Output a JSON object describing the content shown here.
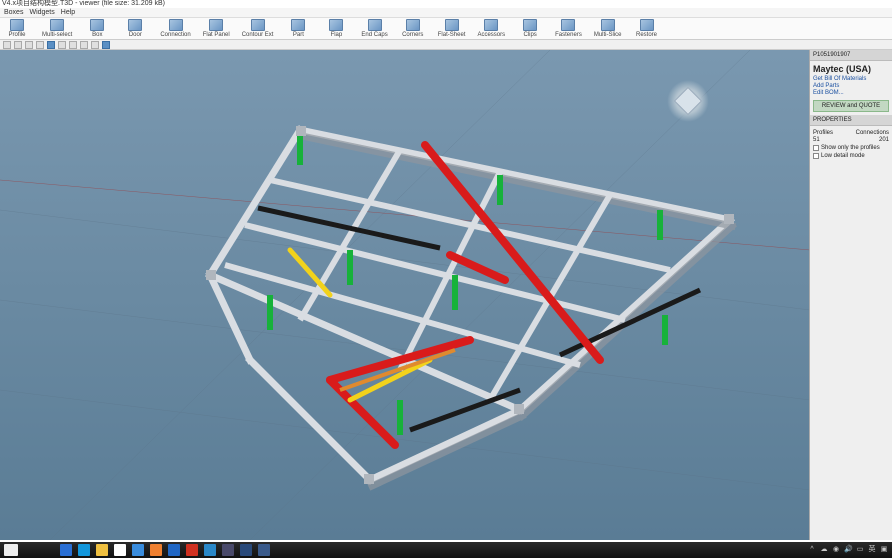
{
  "title": "V4.x项目结构模型.T3D - viewer (file size: 31.209 kB)",
  "menu": {
    "items": [
      "Boxes",
      "Widgets",
      "Help"
    ]
  },
  "ribbon": {
    "items": [
      {
        "label": "Profile"
      },
      {
        "label": "Multi-select"
      },
      {
        "label": "Box"
      },
      {
        "label": "Door"
      },
      {
        "label": "Connection"
      },
      {
        "label": "Flat Panel"
      },
      {
        "label": "Contour Ext"
      },
      {
        "label": "Part"
      },
      {
        "label": "Flap"
      },
      {
        "label": "End Caps"
      },
      {
        "label": "Corners"
      },
      {
        "label": "Flat-Sheet"
      },
      {
        "label": "Accessors"
      },
      {
        "label": "Clips"
      },
      {
        "label": "Fasteners"
      },
      {
        "label": "Multi-Slice"
      },
      {
        "label": "Restore"
      }
    ]
  },
  "panel": {
    "groupHeader": "P1051901907",
    "title": "Maytec (USA)",
    "links": {
      "bom": "Get Bill Of Materials",
      "addParts": "Add Parts",
      "editBom": "Edit BOM..."
    },
    "review": "REVIEW and QUOTE",
    "propsHeader": "PROPERTIES",
    "profilesLabel": "Profiles",
    "profilesVal": "51",
    "connLabel": "Connections",
    "connVal": "201",
    "chk1": "Show only the profiles",
    "chk2": "Low detail mode"
  },
  "chart_data": null
}
